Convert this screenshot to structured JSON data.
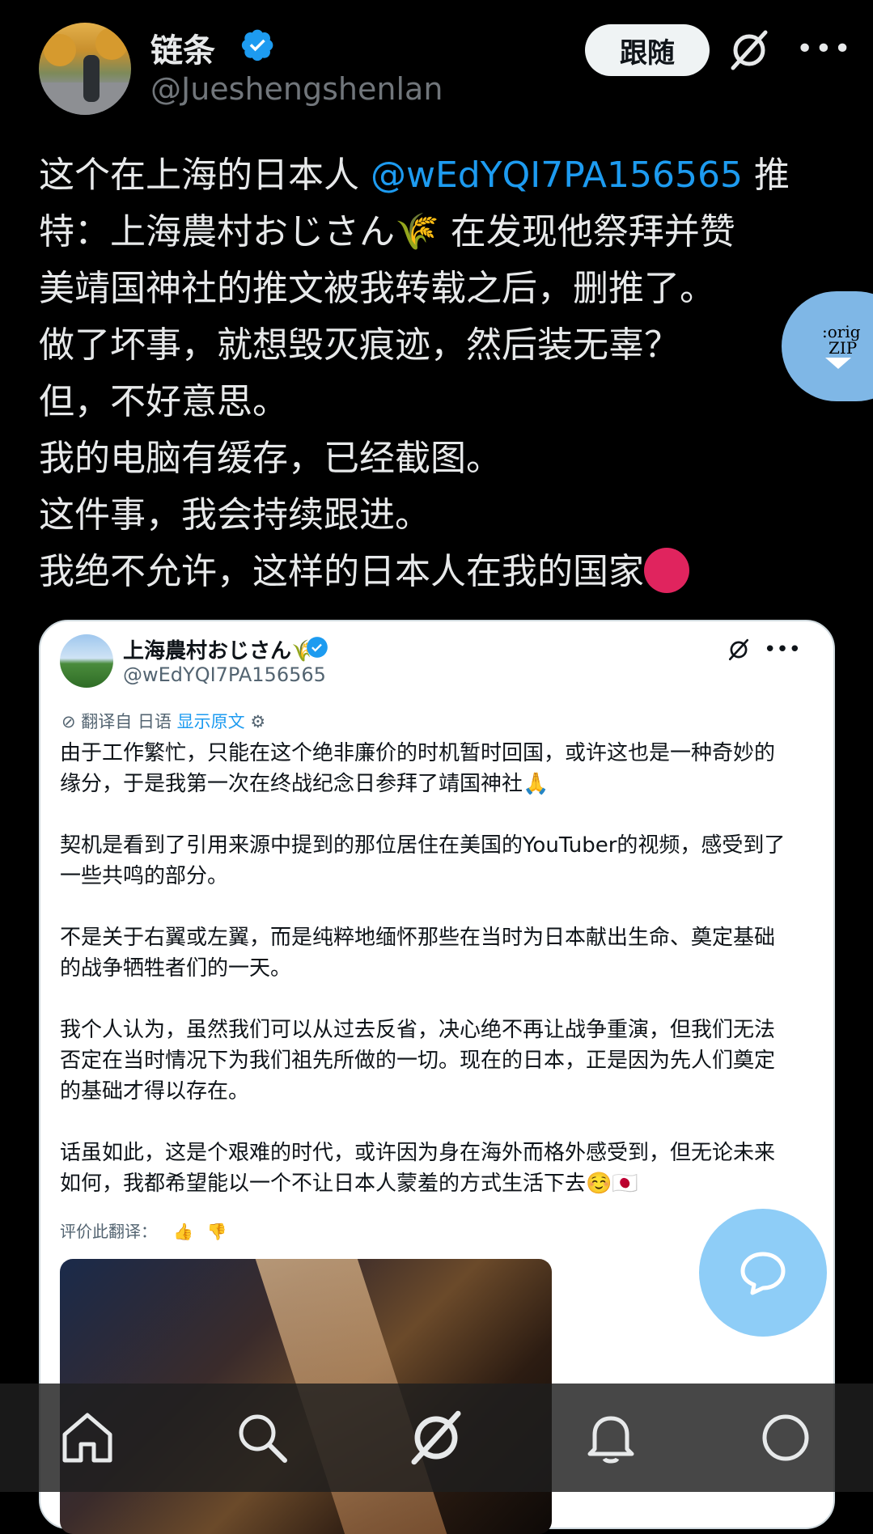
{
  "author": {
    "display_name": "链条",
    "handle": "@Jueshengshenlan"
  },
  "actions": {
    "follow_label": "跟随"
  },
  "tweet": {
    "lines": [
      {
        "before": "这个在上海的日本人 ",
        "mention": "@wEdYQI7PA156565",
        "after": " 推"
      },
      {
        "text": "特：上海農村おじさん🌾 在发现他祭拜并赞"
      },
      {
        "text": "美靖国神社的推文被我转载之后，删推了。"
      },
      {
        "text": "做了坏事，就想毁灭痕迹，然后装无辜？"
      },
      {
        "text": "但，不好意思。"
      },
      {
        "text": "我的电脑有缓存，已经截图。"
      },
      {
        "text": "这件事，我会持续跟进。"
      },
      {
        "text": "我绝不允许，这样的日本人在我的国家"
      }
    ]
  },
  "zip_badge": {
    "line1": ":orig",
    "line2": "ZIP"
  },
  "quoted": {
    "display_name": "上海農村おじさん🌾",
    "handle": "@wEdYQI7PA156565",
    "translated_from": "翻译自 日语",
    "show_original": "显示原文",
    "paragraphs": [
      "由于工作繁忙，只能在这个绝非廉价的时机暂时回国，或许这也是一种奇妙的缘分，于是我第一次在终战纪念日参拜了靖国神社🙏",
      "契机是看到了引用来源中提到的那位居住在美国的YouTuber的视频，感受到了一些共鸣的部分。",
      "不是关于右翼或左翼，而是纯粹地缅怀那些在当时为日本献出生命、奠定基础的战争牺牲者们的一天。",
      "我个人认为，虽然我们可以从过去反省，决心绝不再让战争重演，但我们无法否定在当时情况下为我们祖先所做的一切。现在的日本，正是因为先人们奠定的基础才得以存在。",
      "话虽如此，这是个艰难的时代，或许因为身在海外而格外感受到，但无论未来如何，我都希望能以一个不让日本人蒙羞的方式生活下去☺️🇯🇵"
    ],
    "rate_label": "评价此翻译："
  },
  "nav": [
    "home",
    "search",
    "grok",
    "notifications",
    "messages"
  ],
  "colors": {
    "accent": "#1d9bf0",
    "background": "#000000",
    "card": "#ffffff"
  },
  "icons": {
    "verified": "verified-badge-icon",
    "grok": "grok-icon",
    "more": "more-icon",
    "compose": "compose-icon"
  }
}
